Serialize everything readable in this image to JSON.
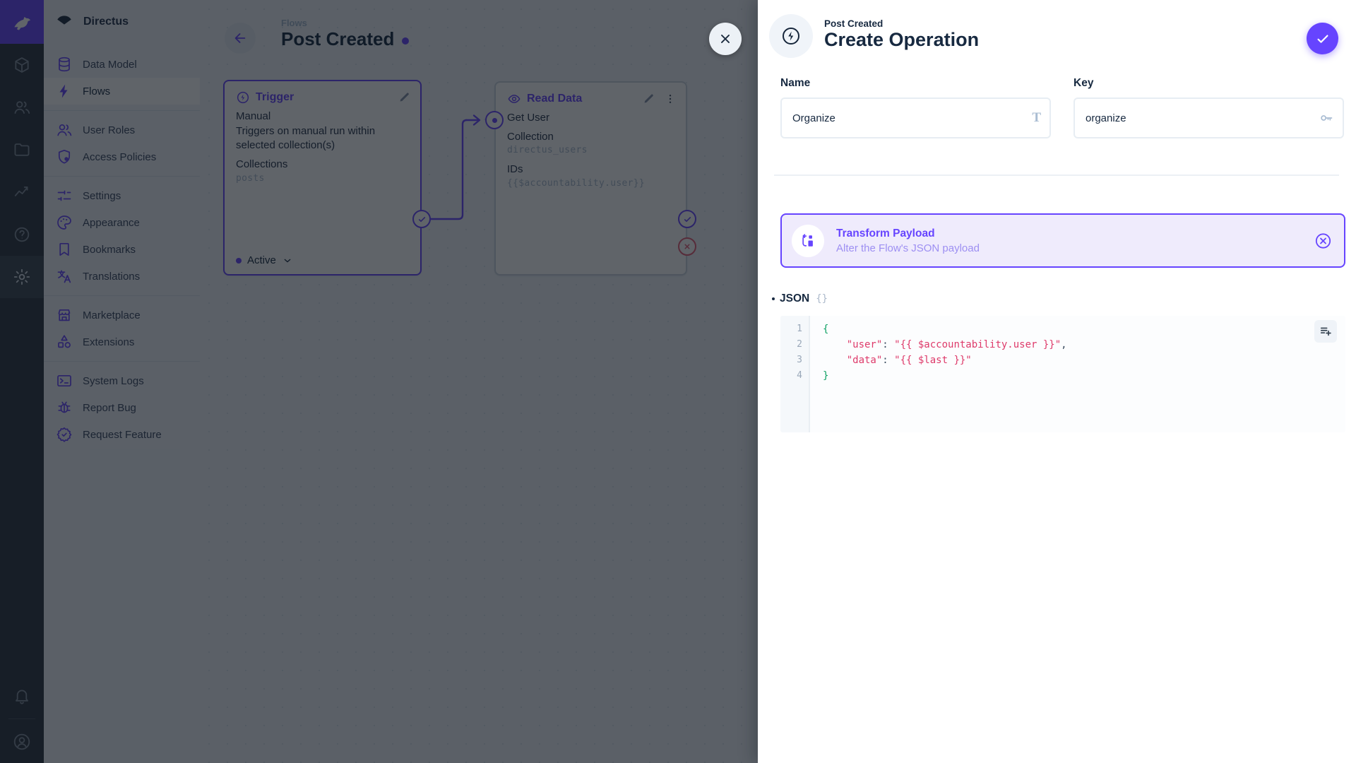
{
  "colors": {
    "accent": "#6644FF",
    "code_green": "#0FA164",
    "code_red": "#DE3A6A",
    "reject": "#E35D76"
  },
  "module_bar": {
    "modules": [
      "directus-logo",
      "data-model-cube",
      "user-directory",
      "file-library",
      "insights",
      "help",
      "settings-gear"
    ],
    "active_module": "settings-gear",
    "bottom": [
      "notifications-bell",
      "user-avatar"
    ]
  },
  "nav": {
    "project_name": "Directus",
    "groups": [
      {
        "items": [
          {
            "label": "Data Model",
            "icon": "database"
          },
          {
            "label": "Flows",
            "icon": "bolt",
            "active": true
          }
        ]
      },
      {
        "items": [
          {
            "label": "User Roles",
            "icon": "users"
          },
          {
            "label": "Access Policies",
            "icon": "shield"
          }
        ]
      },
      {
        "items": [
          {
            "label": "Settings",
            "icon": "tune"
          },
          {
            "label": "Appearance",
            "icon": "palette"
          },
          {
            "label": "Bookmarks",
            "icon": "bookmark"
          },
          {
            "label": "Translations",
            "icon": "translate"
          }
        ]
      },
      {
        "items": [
          {
            "label": "Marketplace",
            "icon": "storefront"
          },
          {
            "label": "Extensions",
            "icon": "category"
          }
        ]
      },
      {
        "items": [
          {
            "label": "System Logs",
            "icon": "terminal"
          },
          {
            "label": "Report Bug",
            "icon": "bug"
          },
          {
            "label": "Request Feature",
            "icon": "feature"
          }
        ]
      }
    ]
  },
  "flow": {
    "breadcrumb": "Flows",
    "title": "Post Created",
    "trigger_panel": {
      "title": "Trigger",
      "type": "Manual",
      "description": "Triggers on manual run within selected collection(s)",
      "collections_label": "Collections",
      "collections_value": "posts",
      "status": "Active"
    },
    "read_panel": {
      "title": "Read Data",
      "name": "Get User",
      "collection_label": "Collection",
      "collection_value": "directus_users",
      "ids_label": "IDs",
      "ids_value": "{{$accountability.user}}"
    }
  },
  "drawer": {
    "breadcrumb": "Post Created",
    "title": "Create Operation",
    "name_field": {
      "label": "Name",
      "value": "Organize"
    },
    "key_field": {
      "label": "Key",
      "value": "organize"
    },
    "banner": {
      "title": "Transform Payload",
      "subtitle": "Alter the Flow's JSON payload"
    },
    "json_label": "JSON",
    "code": {
      "lines": [
        [
          {
            "t": "{",
            "c": "g"
          }
        ],
        [
          {
            "t": "    ",
            "c": "p"
          },
          {
            "t": "\"user\"",
            "c": "r"
          },
          {
            "t": ": ",
            "c": "p"
          },
          {
            "t": "\"{{ $accountability.user }}\"",
            "c": "r"
          },
          {
            "t": ",",
            "c": "p"
          }
        ],
        [
          {
            "t": "    ",
            "c": "p"
          },
          {
            "t": "\"data\"",
            "c": "r"
          },
          {
            "t": ": ",
            "c": "p"
          },
          {
            "t": "\"{{ $last }}\"",
            "c": "r"
          }
        ],
        [
          {
            "t": "}",
            "c": "g"
          }
        ]
      ]
    }
  }
}
